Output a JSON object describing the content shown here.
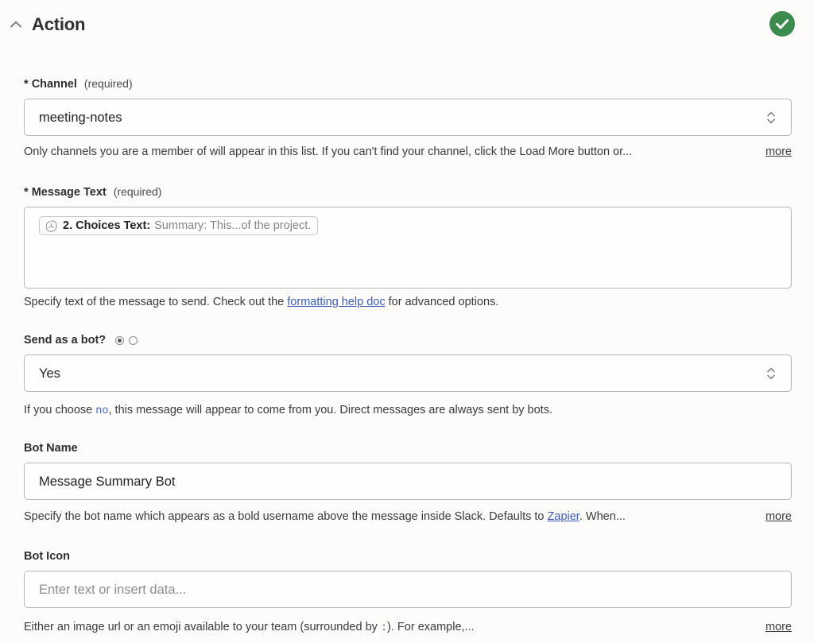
{
  "header": {
    "title": "Action",
    "collapse_icon": "chevron-up-icon",
    "status_icon": "check-circle-icon",
    "status_color": "#3d8b4e"
  },
  "fields": {
    "channel": {
      "label": "Channel",
      "required_marker": "*",
      "required_note": "(required)",
      "value": "meeting-notes",
      "help": "Only channels you are a member of will appear in this list. If you can't find your channel, click the Load More button or...",
      "more_label": "more"
    },
    "message_text": {
      "label": "Message Text",
      "required_marker": "*",
      "required_note": "(required)",
      "token": {
        "icon": "openai-logo-icon",
        "label": "2. Choices Text:",
        "preview": "Summary: This...of the project."
      },
      "help_before": "Specify text of the message to send. Check out the ",
      "help_link": "formatting help doc",
      "help_after": " for advanced options."
    },
    "send_as_bot": {
      "label": "Send as a bot?",
      "radio_selected_index": 0,
      "radio_count": 2,
      "value": "Yes",
      "help_before": "If you choose ",
      "help_code": "no",
      "help_after": ", this message will appear to come from you. Direct messages are always sent by bots."
    },
    "bot_name": {
      "label": "Bot Name",
      "value": "Message Summary Bot",
      "help_before": "Specify the bot name which appears as a bold username above the message inside Slack. Defaults to ",
      "help_link": "Zapier",
      "help_after": ". When...",
      "more_label": "more"
    },
    "bot_icon": {
      "label": "Bot Icon",
      "placeholder": "Enter text or insert data...",
      "help_before": "Either an image url or an emoji available to your team (surrounded by ",
      "help_code": ":",
      "help_after": "). For example,...",
      "more_label": "more"
    }
  }
}
